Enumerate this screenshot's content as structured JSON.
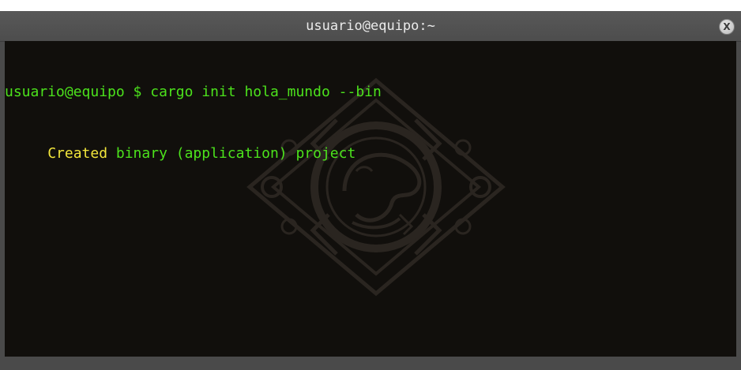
{
  "window": {
    "title": "usuario@equipo:~",
    "close_icon": "X"
  },
  "terminal": {
    "line1": {
      "prompt": "usuario@equipo $ ",
      "command": "cargo init hola_mundo --bin"
    },
    "line2": {
      "indent": "     ",
      "status": "Created",
      "message": " binary (application) project"
    }
  },
  "colors": {
    "terminal_bg": "#110f0c",
    "text_green": "#4ce21c",
    "text_yellow": "#f2e63b",
    "titlebar": "#555555"
  },
  "watermark": {
    "icon": "aztec-serpent-emblem-icon"
  }
}
